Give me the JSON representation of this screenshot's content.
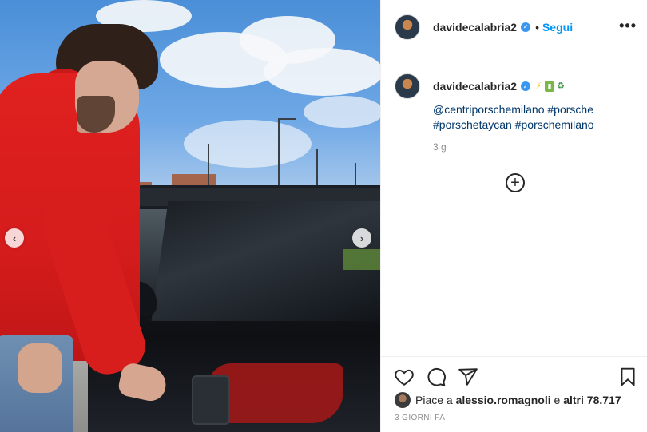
{
  "post": {
    "username": "davidecalabria2",
    "follow_label": "Segui",
    "separator": "•",
    "more_label": "•••",
    "caption": {
      "username": "davidecalabria2",
      "emojis": [
        "⚡",
        "▮",
        "♻"
      ],
      "hashtags": [
        "@centriporschemilano",
        "#porsche",
        "#porschetaycan",
        "#porschemilano"
      ]
    },
    "time_ago": "3 g",
    "likes": {
      "prefix": "Piace a",
      "user": "alessio.romagnoli",
      "middle": "e",
      "others": "altri 78.717"
    },
    "date_label": "3 GIORNI FA"
  },
  "carousel": {
    "prev": "‹",
    "next": "›"
  },
  "icons": {
    "verified": "✓",
    "add_comment": "+"
  },
  "colors": {
    "link": "#00376b",
    "follow": "#0095f6",
    "verified": "#3897f0",
    "muted": "#8e8e8e"
  }
}
